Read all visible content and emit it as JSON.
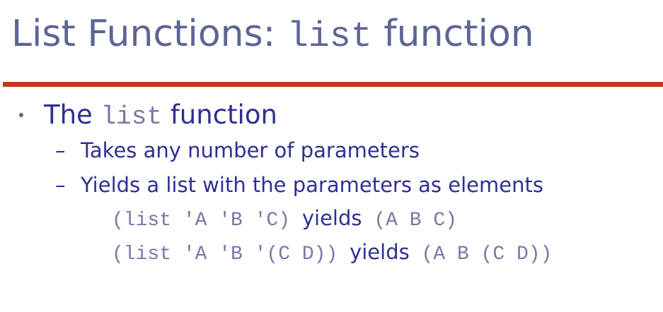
{
  "slide": {
    "title_prefix": "List Functions: ",
    "title_code": "list",
    "title_suffix": " function",
    "bullet": {
      "prefix": "The ",
      "code": "list",
      "suffix": " function"
    },
    "subpoints": [
      {
        "dash": "–",
        "text": "Takes any number of parameters"
      },
      {
        "dash": "–",
        "text": "Yields a list with the parameters as elements"
      }
    ],
    "examples": [
      {
        "expr": "(list 'A 'B 'C)",
        "keyword": "yields",
        "result": "(A B C)"
      },
      {
        "expr": "(list 'A 'B '(C D))",
        "keyword": "yields",
        "result": "(A B (C D))"
      }
    ]
  }
}
